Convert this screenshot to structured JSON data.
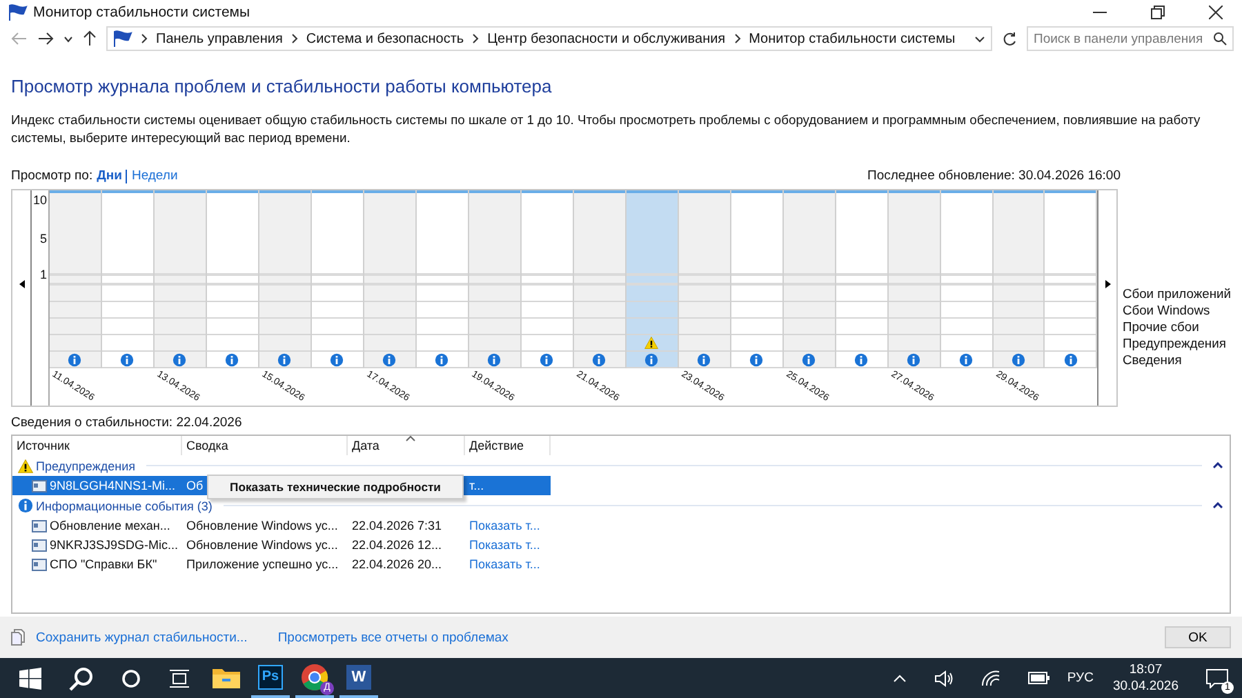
{
  "window": {
    "title": "Монитор стабильности системы"
  },
  "address_bar": {
    "breadcrumbs": [
      "Панель управления",
      "Система и безопасность",
      "Центр безопасности и обслуживания",
      "Монитор стабильности системы"
    ],
    "search_placeholder": "Поиск в панели управления"
  },
  "heading": "Просмотр журнала проблем и стабильности работы компьютера",
  "description": "Индекс стабильности системы оценивает общую стабильность системы по шкале от 1 до 10. Чтобы просмотреть проблемы с оборудованием и программным обеспечением, повлиявшие на работу системы, выберите интересующий вас период времени.",
  "view_by": {
    "label": "Просмотр по:",
    "options": [
      {
        "label": "Дни",
        "selected": true
      },
      {
        "label": "Недели",
        "selected": false
      }
    ]
  },
  "last_update": "Последнее обновление: 30.04.2026 16:00",
  "chart": {
    "axis_ticks": [
      "10",
      "5",
      "1"
    ],
    "legend": [
      {
        "label": "Сбои приложений",
        "kind": "app_failures"
      },
      {
        "label": "Сбои Windows",
        "kind": "windows_failures"
      },
      {
        "label": "Прочие сбои",
        "kind": "other_failures"
      },
      {
        "label": "Предупреждения",
        "kind": "warning"
      },
      {
        "label": "Сведения",
        "kind": "info"
      }
    ],
    "days": [
      {
        "label": "11.04.2026",
        "selected": false,
        "warning": false,
        "info": true
      },
      {
        "selected": false,
        "warning": false,
        "info": true
      },
      {
        "label": "13.04.2026",
        "selected": false,
        "warning": false,
        "info": true
      },
      {
        "selected": false,
        "warning": false,
        "info": true
      },
      {
        "label": "15.04.2026",
        "selected": false,
        "warning": false,
        "info": true
      },
      {
        "selected": false,
        "warning": false,
        "info": true
      },
      {
        "label": "17.04.2026",
        "selected": false,
        "warning": false,
        "info": true
      },
      {
        "selected": false,
        "warning": false,
        "info": true
      },
      {
        "label": "19.04.2026",
        "selected": false,
        "warning": false,
        "info": true
      },
      {
        "selected": false,
        "warning": false,
        "info": true
      },
      {
        "label": "21.04.2026",
        "selected": false,
        "warning": false,
        "info": true
      },
      {
        "selected": true,
        "warning": true,
        "info": true
      },
      {
        "label": "23.04.2026",
        "selected": false,
        "warning": false,
        "info": true
      },
      {
        "selected": false,
        "warning": false,
        "info": true
      },
      {
        "label": "25.04.2026",
        "selected": false,
        "warning": false,
        "info": true
      },
      {
        "selected": false,
        "warning": false,
        "info": true
      },
      {
        "label": "27.04.2026",
        "selected": false,
        "warning": false,
        "info": true
      },
      {
        "selected": false,
        "warning": false,
        "info": true
      },
      {
        "label": "29.04.2026",
        "selected": false,
        "warning": false,
        "info": true
      },
      {
        "selected": false,
        "warning": false,
        "info": true
      }
    ]
  },
  "details_title": "Сведения о стабильности: 22.04.2026",
  "table": {
    "columns": [
      "Источник",
      "Сводка",
      "Дата",
      "Действие"
    ],
    "groups": [
      {
        "title": "Предупреждения",
        "kind": "warning",
        "expanded": true,
        "rows": [
          {
            "source": "9N8LGGH4NNS1-Mi...",
            "summary": "Об",
            "action": "т...",
            "selected": true
          }
        ]
      },
      {
        "title": "Информационные события (3)",
        "kind": "info",
        "expanded": true,
        "rows": [
          {
            "source": "Обновление механ...",
            "summary": "Обновление Windows ус...",
            "date": "22.04.2026 7:31",
            "action": "Показать т...",
            "selected": false
          },
          {
            "source": "9NKRJ3SJ9SDG-Mic...",
            "summary": "Обновление Windows ус...",
            "date": "22.04.2026 12...",
            "action": "Показать т...",
            "selected": false
          },
          {
            "source": "СПО \"Справки БК\"",
            "summary": "Приложение успешно ус...",
            "date": "22.04.2026 20...",
            "action": "Показать т...",
            "selected": false
          }
        ]
      }
    ]
  },
  "context_menu": {
    "items": [
      "Показать технические подробности"
    ]
  },
  "footer": {
    "links": [
      "Сохранить журнал стабильности...",
      "Просмотреть все отчеты о проблемах"
    ],
    "ok": "OK"
  },
  "taskbar": {
    "apps": [
      {
        "kind": "explorer",
        "running": false
      },
      {
        "kind": "photoshop",
        "label": "Ps",
        "running": true
      },
      {
        "kind": "chrome",
        "badge": "Д",
        "running": true
      },
      {
        "kind": "word",
        "label": "W",
        "running": true
      }
    ],
    "language": "РУС",
    "time": "18:07",
    "date": "30.04.2026",
    "notifications": "1"
  }
}
